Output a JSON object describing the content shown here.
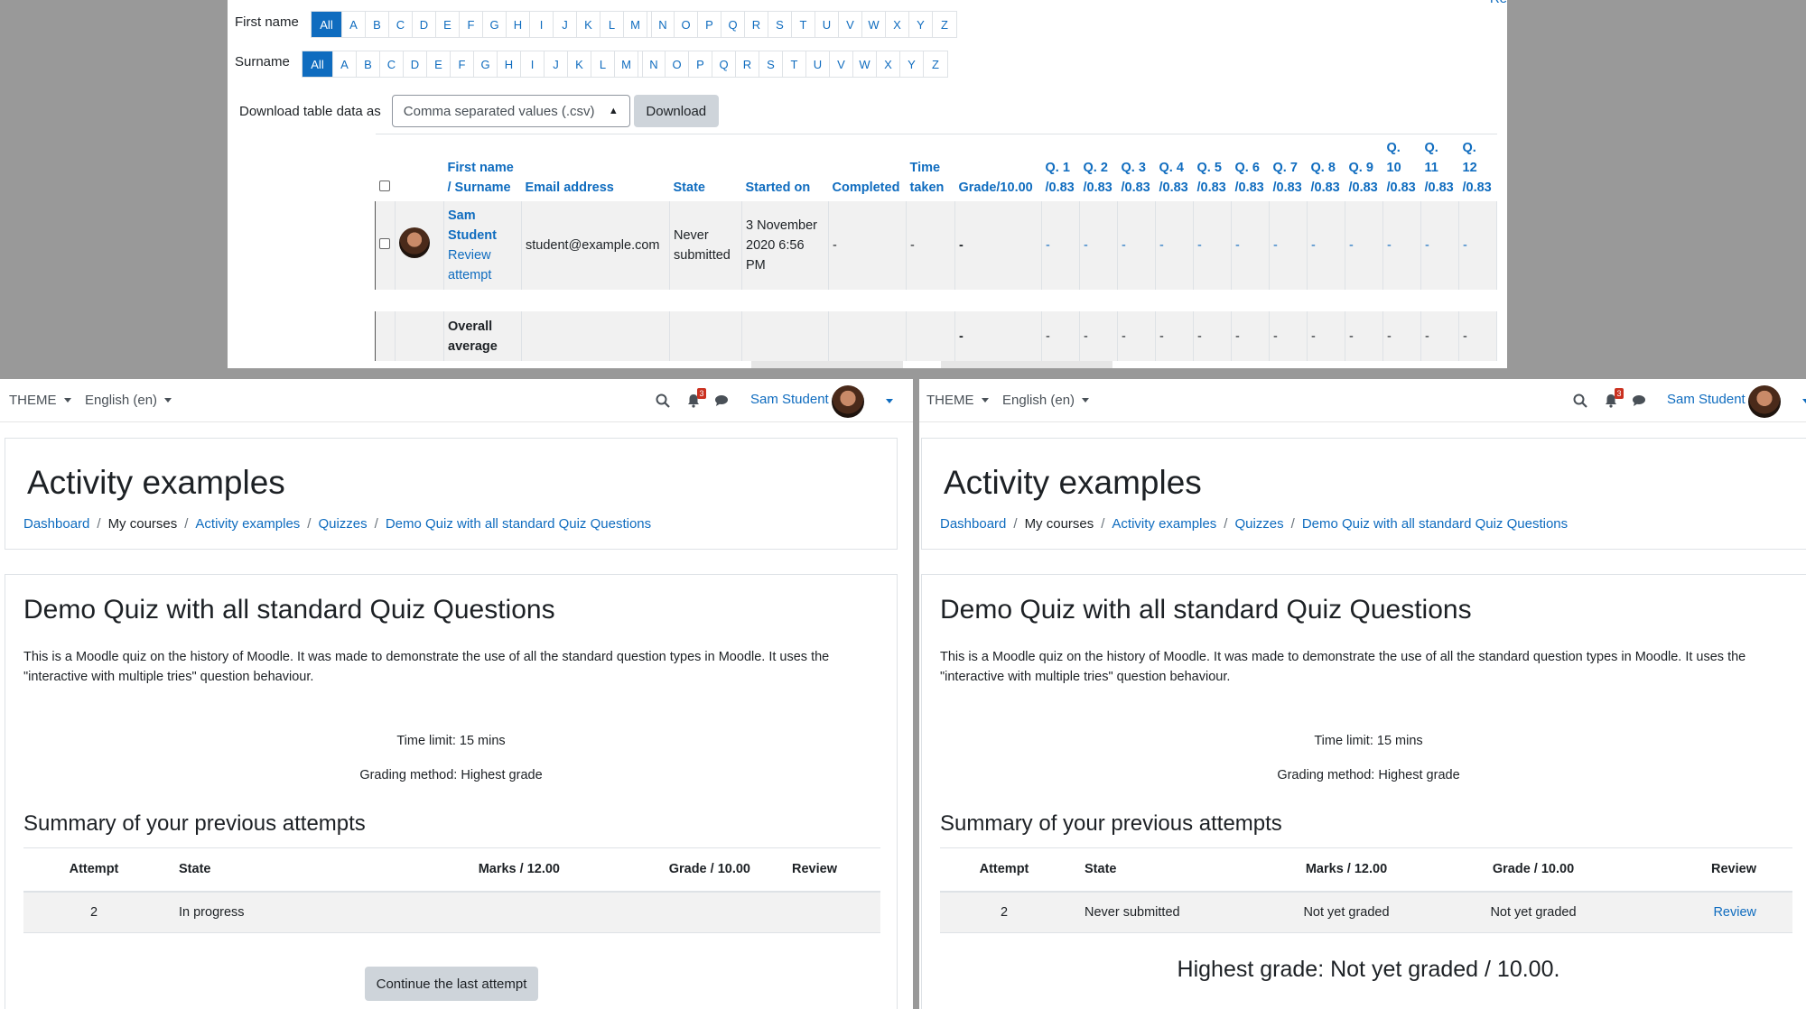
{
  "report": {
    "corner_link": "Re",
    "firstname_label": "First name",
    "surname_label": "Surname",
    "letters_all": "All",
    "letters": [
      "A",
      "B",
      "C",
      "D",
      "E",
      "F",
      "G",
      "H",
      "I",
      "J",
      "K",
      "L",
      "M",
      "N",
      "O",
      "P",
      "Q",
      "R",
      "S",
      "T",
      "U",
      "V",
      "W",
      "X",
      "Y",
      "Z"
    ],
    "download_label": "Download table data as",
    "download_format": "Comma separated values (.csv)",
    "download_button": "Download",
    "columns": {
      "first_name": "First name",
      "surname": "/ Surname",
      "email": "Email address",
      "state": "State",
      "started_on": "Started on",
      "completed": "Completed",
      "time_taken_1": "Time",
      "time_taken_2": "taken",
      "grade": "Grade/10.00"
    },
    "questions": [
      {
        "l1": "",
        "l2": "Q. 1",
        "l3": "/0.83"
      },
      {
        "l1": "",
        "l2": "Q. 2",
        "l3": "/0.83"
      },
      {
        "l1": "",
        "l2": "Q. 3",
        "l3": "/0.83"
      },
      {
        "l1": "",
        "l2": "Q. 4",
        "l3": "/0.83"
      },
      {
        "l1": "",
        "l2": "Q. 5",
        "l3": "/0.83"
      },
      {
        "l1": "",
        "l2": "Q. 6",
        "l3": "/0.83"
      },
      {
        "l1": "",
        "l2": "Q. 7",
        "l3": "/0.83"
      },
      {
        "l1": "",
        "l2": "Q. 8",
        "l3": "/0.83"
      },
      {
        "l1": "",
        "l2": "Q. 9",
        "l3": "/0.83"
      },
      {
        "l1": "Q.",
        "l2": "10",
        "l3": "/0.83"
      },
      {
        "l1": "Q.",
        "l2": "11",
        "l3": "/0.83"
      },
      {
        "l1": "Q.",
        "l2": "12",
        "l3": "/0.83"
      }
    ],
    "row": {
      "name_1": "Sam",
      "name_2": "Student",
      "review_1": "Review",
      "review_2": "attempt",
      "email": "student@example.com",
      "state_1": "Never",
      "state_2": "submitted",
      "started_1": "3 November",
      "started_2": "2020 6:56",
      "started_3": "PM",
      "completed": "-",
      "time_taken": "-",
      "grade": "-",
      "q_values": [
        "-",
        "-",
        "-",
        "-",
        "-",
        "-",
        "-",
        "-",
        "-",
        "-",
        "-",
        "-"
      ]
    },
    "average": {
      "label_1": "Overall",
      "label_2": "average",
      "grade": "-",
      "q_values": [
        "-",
        "-",
        "-",
        "-",
        "-",
        "-",
        "-",
        "-",
        "-",
        "-",
        "-",
        "-"
      ]
    }
  },
  "navbar": {
    "theme": "THEME",
    "language": "English (en)",
    "notifications_count": "3",
    "user_name": "Sam Student"
  },
  "course": {
    "title": "Activity examples",
    "breadcrumb": [
      "Dashboard",
      "My courses",
      "Activity examples",
      "Quizzes",
      "Demo Quiz with all standard Quiz Questions"
    ]
  },
  "quiz": {
    "title": "Demo Quiz with all standard Quiz Questions",
    "intro_1": "This is a Moodle quiz on the history of Moodle. It was made to demonstrate the use of all the standard question types in Moodle. It uses the",
    "intro_2": "\"interactive with multiple tries\" question behaviour.",
    "time_limit": "Time limit: 15 mins",
    "grading_method": "Grading method: Highest grade",
    "summary_heading": "Summary of your previous attempts",
    "columns": [
      "Attempt",
      "State",
      "Marks / 12.00",
      "Grade / 10.00",
      "Review"
    ]
  },
  "left_attempt": {
    "attempt": "2",
    "state": "In progress",
    "marks": "",
    "grade": "",
    "review": "",
    "continue_button": "Continue the last attempt"
  },
  "right_attempt": {
    "attempt": "2",
    "state": "Never submitted",
    "marks": "Not yet graded",
    "grade": "Not yet graded",
    "review": "Review",
    "highest_grade": "Highest grade: Not yet graded / 10.00."
  }
}
